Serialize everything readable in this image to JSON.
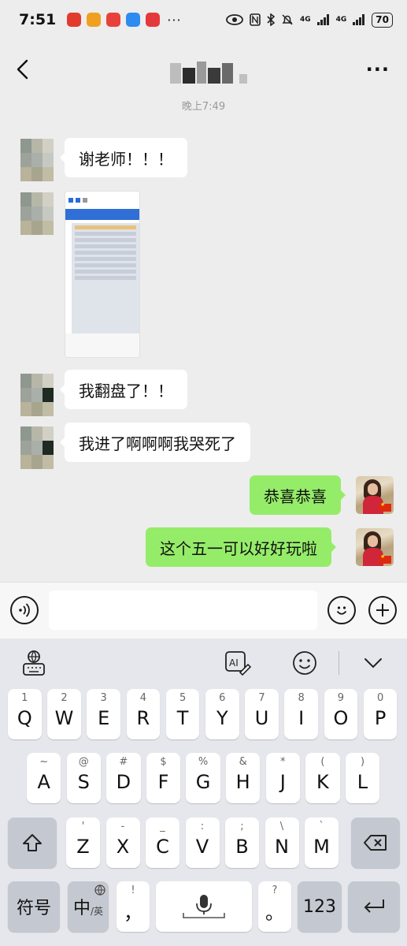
{
  "status_bar": {
    "time": "7:51",
    "battery": "70",
    "network_1": "4G",
    "network_2": "4G",
    "app_icons": [
      "app-icon",
      "app-icon",
      "app-icon",
      "app-icon",
      "app-icon"
    ],
    "more": "···"
  },
  "header": {
    "back_icon": "chevron-left-icon",
    "more_label": "···"
  },
  "chat": {
    "timestamp": "晚上7:49",
    "messages": [
      {
        "side": "left",
        "type": "text",
        "text": "谢老师！！！"
      },
      {
        "side": "left",
        "type": "image"
      },
      {
        "side": "left",
        "type": "text",
        "text": "我翻盘了！！"
      },
      {
        "side": "left",
        "type": "text",
        "text": "我进了啊啊啊我哭死了"
      },
      {
        "side": "right",
        "type": "text",
        "text": "恭喜恭喜"
      },
      {
        "side": "right",
        "type": "text",
        "text": "这个五一可以好好玩啦"
      }
    ]
  },
  "input_bar": {
    "voice_icon": "voice-icon",
    "emoji_icon": "emoji-icon",
    "plus_icon": "plus-icon"
  },
  "keyboard": {
    "row1": [
      {
        "sub": "1",
        "main": "Q"
      },
      {
        "sub": "2",
        "main": "W"
      },
      {
        "sub": "3",
        "main": "E"
      },
      {
        "sub": "4",
        "main": "R"
      },
      {
        "sub": "5",
        "main": "T"
      },
      {
        "sub": "6",
        "main": "Y"
      },
      {
        "sub": "7",
        "main": "U"
      },
      {
        "sub": "8",
        "main": "I"
      },
      {
        "sub": "9",
        "main": "O"
      },
      {
        "sub": "0",
        "main": "P"
      }
    ],
    "row2": [
      {
        "sub": "~",
        "main": "A"
      },
      {
        "sub": "@",
        "main": "S"
      },
      {
        "sub": "#",
        "main": "D"
      },
      {
        "sub": "$",
        "main": "F"
      },
      {
        "sub": "%",
        "main": "G"
      },
      {
        "sub": "&",
        "main": "H"
      },
      {
        "sub": "*",
        "main": "J"
      },
      {
        "sub": "(",
        "main": "K"
      },
      {
        "sub": ")",
        "main": "L"
      }
    ],
    "row3": [
      {
        "sub": "'",
        "main": "Z"
      },
      {
        "sub": "-",
        "main": "X"
      },
      {
        "sub": "_",
        "main": "C"
      },
      {
        "sub": ":",
        "main": "V"
      },
      {
        "sub": ";",
        "main": "B"
      },
      {
        "sub": "\\",
        "main": "N"
      },
      {
        "sub": "`",
        "main": "M"
      }
    ],
    "symbols_label": "符号",
    "lang_label_main": "中",
    "lang_label_sub": "/英",
    "comma_sub": "!",
    "comma_main": "，",
    "period_sub": "?",
    "period_main": "。",
    "numbers_label": "123"
  }
}
